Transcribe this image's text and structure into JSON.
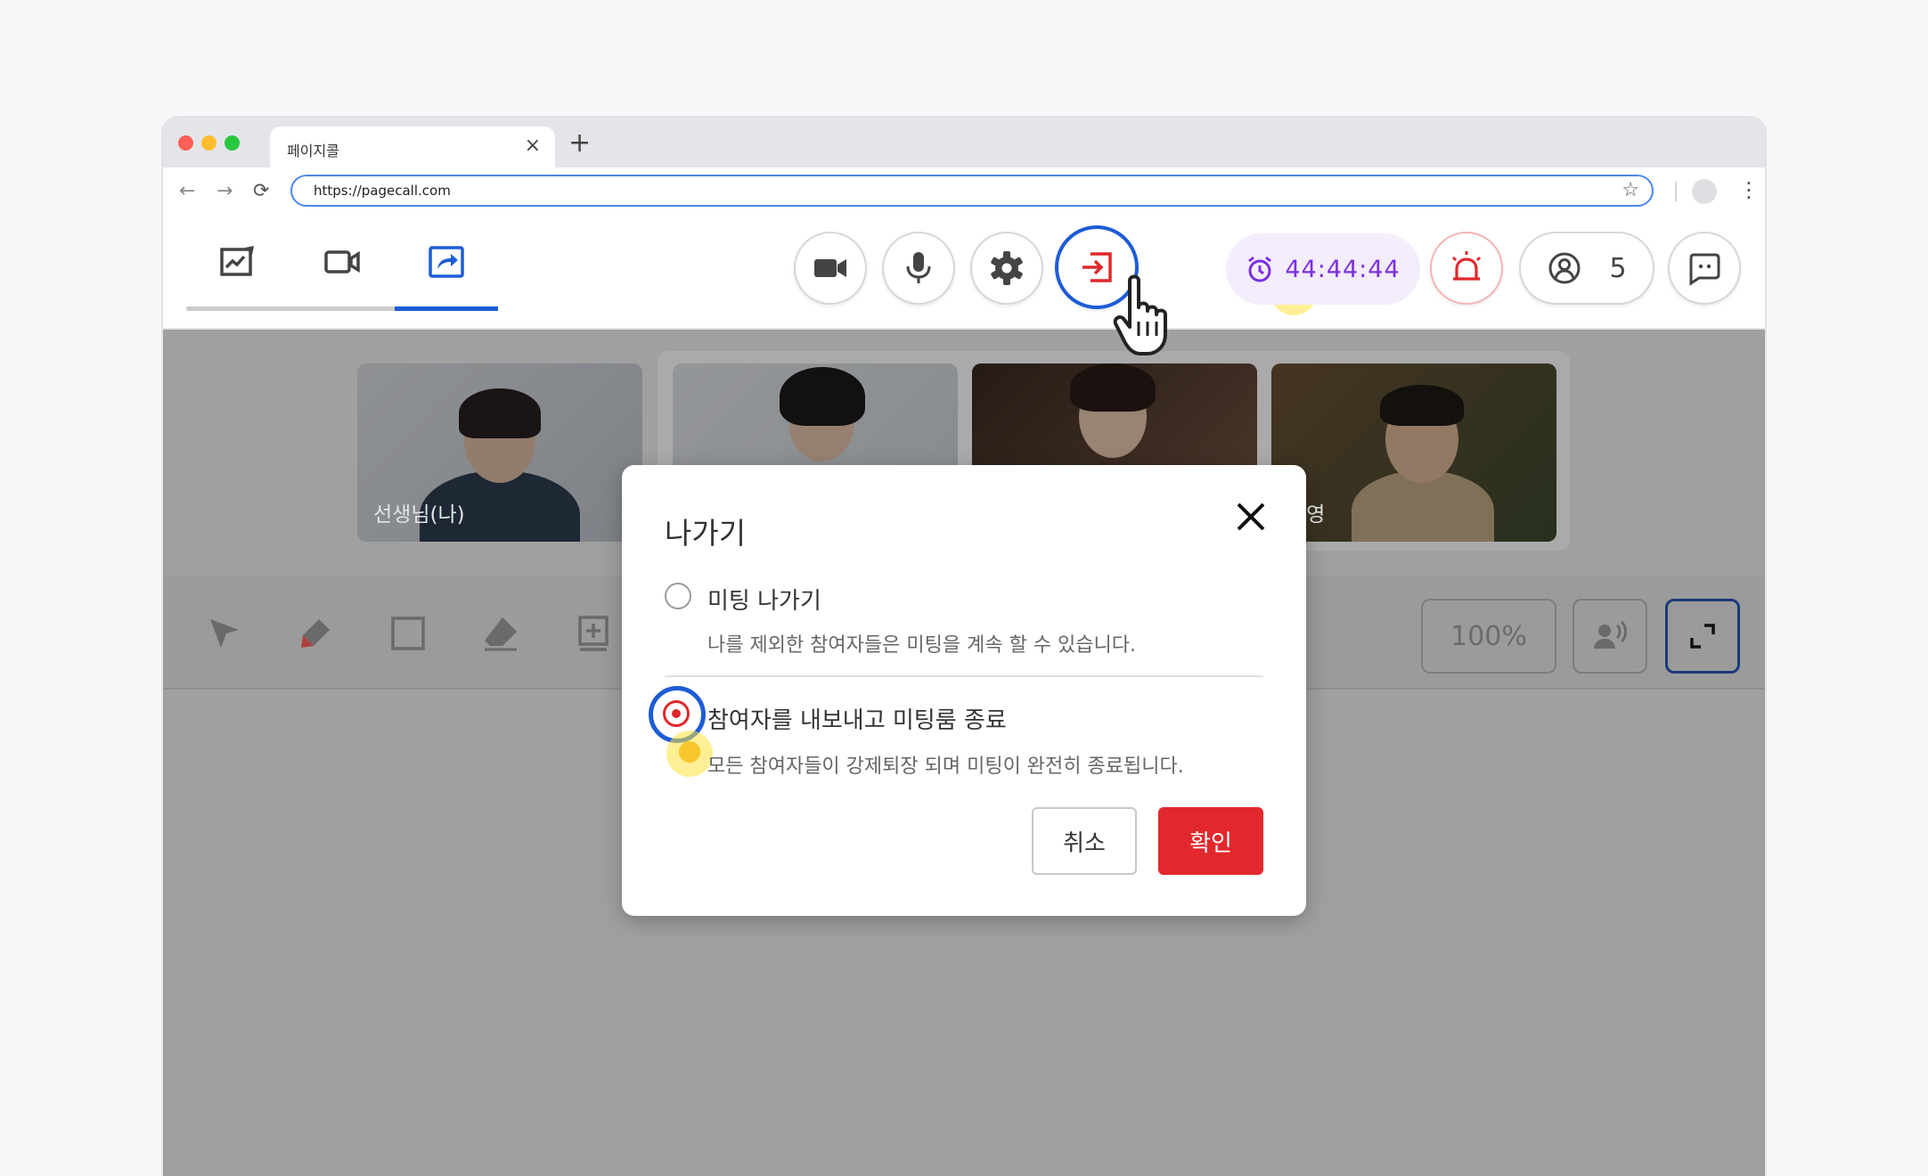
{
  "browser": {
    "tab_title": "페이지콜",
    "tab_close": "×",
    "new_tab": "+",
    "url": "https://pagecall.com",
    "nav_back": "←",
    "nav_forward": "→",
    "nav_reload": "⟳",
    "star": "☆",
    "menu": "⋮"
  },
  "toolbar": {
    "timer": "44:44:44",
    "participants_count": "5",
    "colors": {
      "active_tab": "#1d5cd6",
      "timer": "#7c2fe0",
      "exit_icon": "#e0282b",
      "alert_icon": "#e0282b"
    }
  },
  "videos": [
    {
      "label": "선생님(나)"
    },
    {
      "label": ""
    },
    {
      "label": ""
    },
    {
      "label": "수영"
    }
  ],
  "tools": {
    "zoom": "100%"
  },
  "modal": {
    "title": "나가기",
    "options": [
      {
        "title": "미팅 나가기",
        "description": "나를 제외한 참여자들은 미팅을 계속 할 수 있습니다.",
        "selected": false
      },
      {
        "title": "참여자를 내보내고 미팅룸 종료",
        "description": "모든 참여자들이 강제퇴장 되며 미팅이 완전히 종료됩니다.",
        "selected": true
      }
    ],
    "cancel_label": "취소",
    "confirm_label": "확인",
    "colors": {
      "confirm": "#e3282d",
      "selected_radio": "#e0282b",
      "focus_ring": "#1d5cd6"
    }
  }
}
